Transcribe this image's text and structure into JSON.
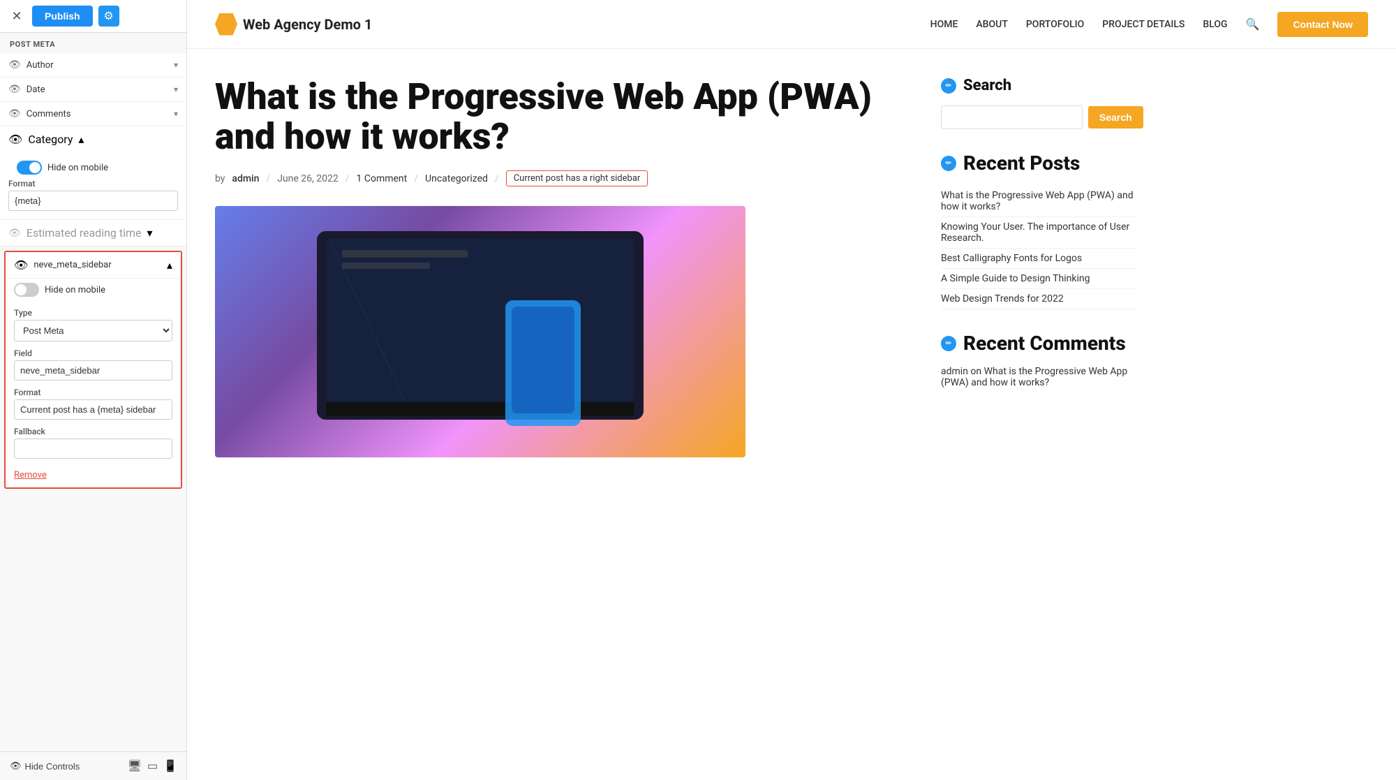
{
  "topbar": {
    "close_label": "✕",
    "publish_label": "Publish",
    "settings_icon": "⚙"
  },
  "left_panel": {
    "section_title": "POST META",
    "meta_rows": [
      {
        "id": "author",
        "label": "Author",
        "visible": true,
        "expanded": false
      },
      {
        "id": "date",
        "label": "Date",
        "visible": true,
        "expanded": false
      },
      {
        "id": "comments",
        "label": "Comments",
        "visible": true,
        "expanded": false
      },
      {
        "id": "category",
        "label": "Category",
        "visible": true,
        "expanded": true
      }
    ],
    "category_section": {
      "hide_on_mobile_label": "Hide on mobile",
      "format_label": "Format",
      "format_value": "{meta}"
    },
    "estimated_reading_time": {
      "label": "Estimated reading time",
      "visible": false
    },
    "highlighted": {
      "name": "neve_meta_sidebar",
      "hide_on_mobile_label": "Hide on mobile",
      "type_label": "Type",
      "type_value": "Post Meta",
      "field_label": "Field",
      "field_value": "neve_meta_sidebar",
      "format_label": "Format",
      "format_value": "Current post has a {meta} sidebar",
      "fallback_label": "Fallback",
      "fallback_value": "",
      "remove_label": "Remove"
    },
    "bottom_bar": {
      "hide_controls_label": "Hide Controls",
      "desktop_icon": "🖥",
      "tablet_icon": "▭",
      "mobile_icon": "📱"
    }
  },
  "navbar": {
    "brand_name": "Web Agency Demo 1",
    "nav_items": [
      {
        "label": "HOME"
      },
      {
        "label": "ABOUT"
      },
      {
        "label": "PORTOFOLIO"
      },
      {
        "label": "PROJECT DETAILS"
      },
      {
        "label": "BLOG"
      }
    ],
    "contact_label": "Contact Now"
  },
  "article": {
    "title": "What is the Progressive Web App (PWA) and how it works?",
    "meta_by": "by",
    "author": "admin",
    "date": "June 26, 2022",
    "comments": "1 Comment",
    "category": "Uncategorized",
    "sidebar_badge": "Current post has a right sidebar"
  },
  "sidebar_widget": {
    "search_title": "Search",
    "search_placeholder": "",
    "search_button": "Search",
    "recent_posts_title": "Recent Posts",
    "recent_posts": [
      "What is the Progressive Web App (PWA) and how it works?",
      "Knowing Your User. The importance of User Research.",
      "Best Calligraphy Fonts for Logos",
      "A Simple Guide to Design Thinking",
      "Web Design Trends for 2022"
    ],
    "recent_comments_title": "Recent Comments",
    "recent_comment": "admin on What is the Progressive Web App (PWA) and how it works?"
  }
}
